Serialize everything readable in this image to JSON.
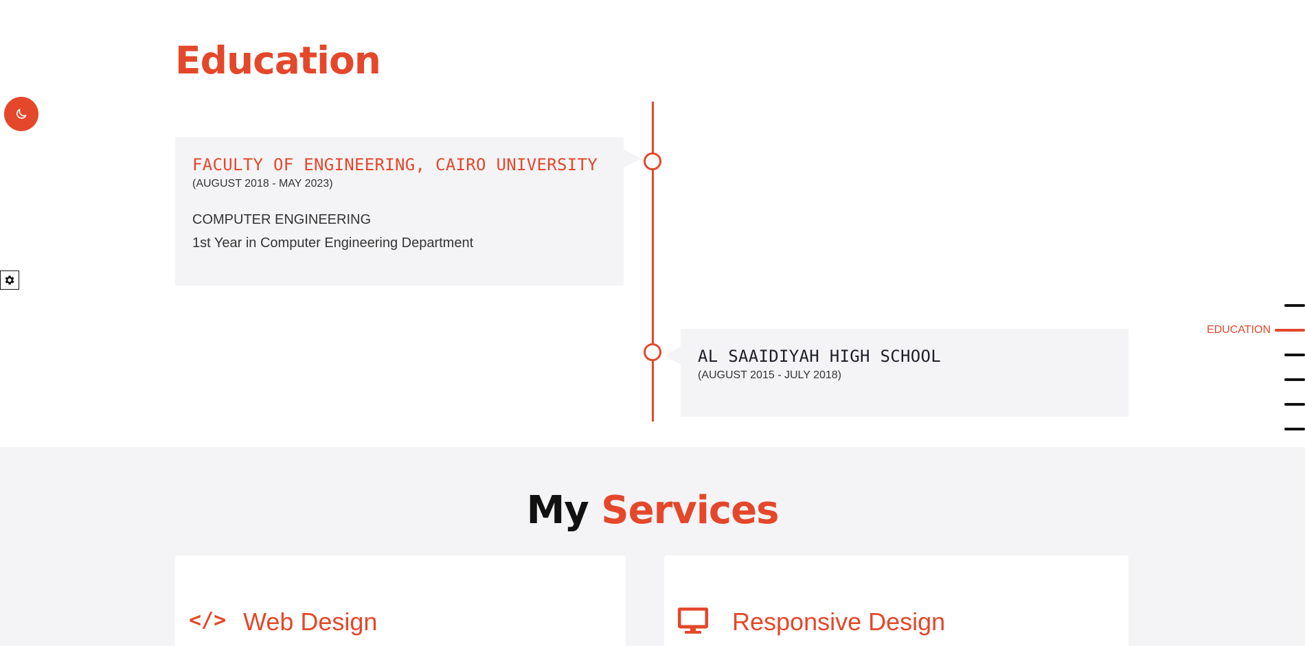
{
  "education": {
    "title": "Education",
    "entries": [
      {
        "school": "FACULTY OF ENGINEERING, CAIRO UNIVERSITY",
        "dates": "(AUGUST 2018 - MAY 2023)",
        "major": "COMPUTER ENGINEERING",
        "detail": "1st Year in Computer Engineering Department"
      },
      {
        "school": "AL SAAIDIYAH HIGH SCHOOL",
        "dates": "(AUGUST 2015 - JULY 2018)"
      }
    ]
  },
  "controls": {
    "theme_toggle_icon": "moon-icon",
    "settings_icon": "gear-icon"
  },
  "side_nav": {
    "active_label": "EDUCATION",
    "item_count": 6,
    "active_index": 1
  },
  "services": {
    "title_prefix": "My",
    "title_accent": "Services",
    "cards": [
      {
        "icon": "code-icon",
        "icon_glyph": "</>",
        "label": "Web Design"
      },
      {
        "icon": "monitor-icon",
        "label": "Responsive Design"
      }
    ]
  },
  "colors": {
    "accent": "#e4472a",
    "card_bg": "#f4f4f6",
    "text_dark": "#1e1e28"
  }
}
